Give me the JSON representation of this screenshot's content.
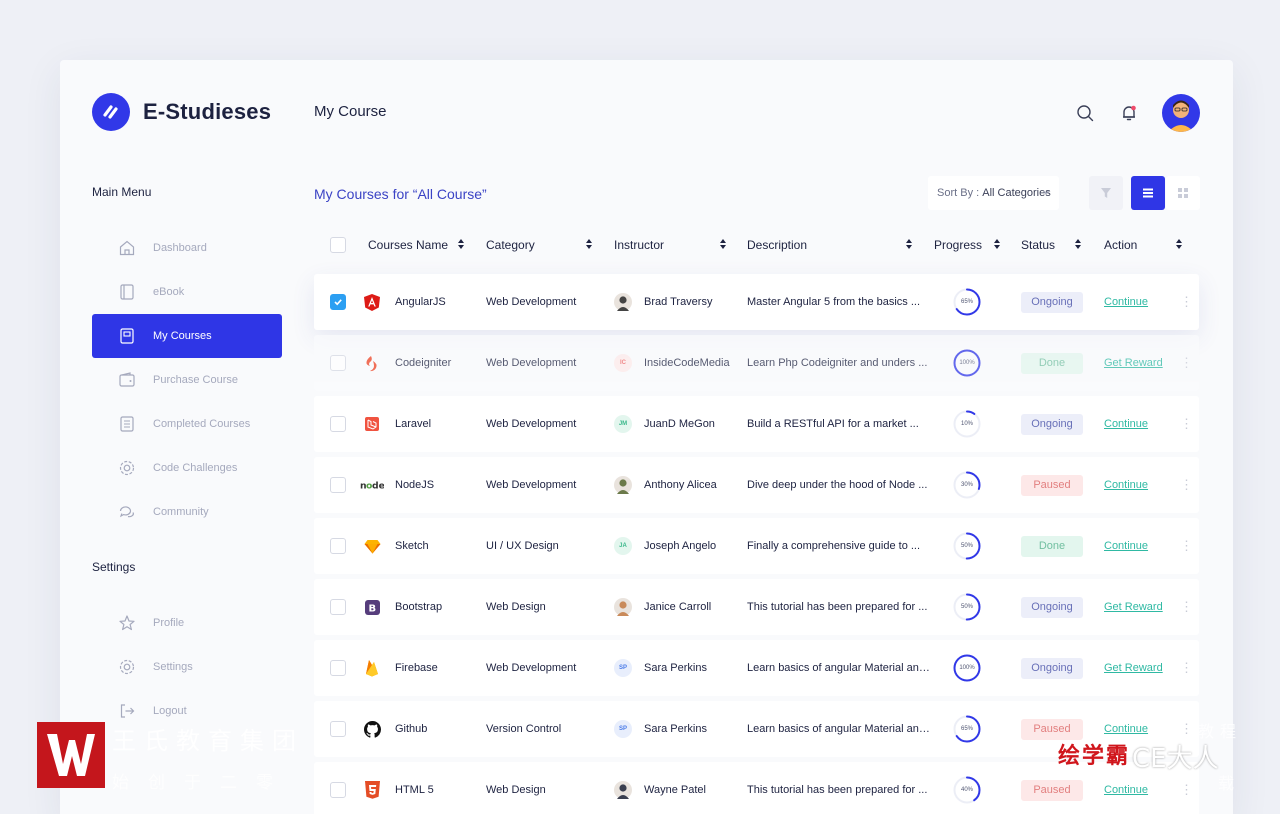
{
  "app": {
    "name": "E-Studieses",
    "page_title": "My Course"
  },
  "sidebar": {
    "main_menu_title": "Main Menu",
    "items": [
      {
        "label": "Dashboard",
        "icon": "home-icon"
      },
      {
        "label": "eBook",
        "icon": "book-icon"
      },
      {
        "label": "My Courses",
        "icon": "courses-icon",
        "active": true
      },
      {
        "label": "Purchase Course",
        "icon": "wallet-icon"
      },
      {
        "label": "Completed Courses",
        "icon": "checklist-icon"
      },
      {
        "label": "Code Challenges",
        "icon": "gear-icon"
      },
      {
        "label": "Community",
        "icon": "chat-icon"
      }
    ],
    "settings_title": "Settings",
    "settings_items": [
      {
        "label": "Profile",
        "icon": "star-icon"
      },
      {
        "label": "Settings",
        "icon": "gear-icon"
      },
      {
        "label": "Logout",
        "icon": "logout-icon"
      }
    ]
  },
  "content": {
    "subtitle": "My Courses for “All Course”",
    "sort": {
      "label": "Sort By :",
      "value": "All Categories"
    }
  },
  "table": {
    "headers": {
      "name": "Courses Name",
      "category": "Category",
      "instructor": "Instructor",
      "description": "Description",
      "progress": "Progress",
      "status": "Status",
      "action": "Action"
    },
    "rows": [
      {
        "name": "AngularJS",
        "category": "Web Development",
        "instructor": "Brad Traversy",
        "initials": "",
        "description": "Master Angular 5 from the basics ...",
        "progress": 65,
        "progress_label": "65%",
        "status": "Ongoing",
        "action": "Continue",
        "checked": true
      },
      {
        "name": "Codeigniter",
        "category": "Web Development",
        "instructor": "InsideCodeMedia",
        "initials": "IC",
        "description": "Learn Php Codeigniter and unders ...",
        "progress": 100,
        "progress_label": "100%",
        "status": "Done",
        "action": "Get Reward",
        "checked": false
      },
      {
        "name": "Laravel",
        "category": "Web Development",
        "instructor": "JuanD MeGon",
        "initials": "JM",
        "description": "Build a RESTful API for a market ...",
        "progress": 10,
        "progress_label": "10%",
        "status": "Ongoing",
        "action": "Continue",
        "checked": false
      },
      {
        "name": "NodeJS",
        "category": "Web Development",
        "instructor": "Anthony Alicea",
        "initials": "",
        "description": "Dive deep under the hood of Node ...",
        "progress": 30,
        "progress_label": "30%",
        "status": "Paused",
        "action": "Continue",
        "checked": false
      },
      {
        "name": "Sketch",
        "category": "UI / UX Design",
        "instructor": "Joseph Angelo",
        "initials": "JA",
        "description": "Finally a comprehensive guide to ...",
        "progress": 50,
        "progress_label": "50%",
        "status": "Done",
        "action": "Continue",
        "checked": false
      },
      {
        "name": "Bootstrap",
        "category": "Web Design",
        "instructor": "Janice Carroll",
        "initials": "",
        "description": "This tutorial has been prepared for ...",
        "progress": 50,
        "progress_label": "50%",
        "status": "Ongoing",
        "action": "Get Reward",
        "checked": false
      },
      {
        "name": "Firebase",
        "category": "Web Development",
        "instructor": "Sara Perkins",
        "initials": "SP",
        "description": "Learn basics of angular Material and ...",
        "progress": 100,
        "progress_label": "100%",
        "status": "Ongoing",
        "action": "Get Reward",
        "checked": false
      },
      {
        "name": "Github",
        "category": "Version Control",
        "instructor": "Sara Perkins",
        "initials": "SP",
        "description": "Learn basics of angular Material and ...",
        "progress": 65,
        "progress_label": "65%",
        "status": "Paused",
        "action": "Continue",
        "checked": false
      },
      {
        "name": "HTML 5",
        "category": "Web Design",
        "instructor": "Wayne Patel",
        "initials": "",
        "description": "This tutorial has been prepared for ...",
        "progress": 40,
        "progress_label": "40%",
        "status": "Paused",
        "action": "Continue",
        "checked": false
      }
    ]
  },
  "colors": {
    "accent": "#2f36e6",
    "link": "#2fb9a3",
    "ongoing": "#6870b8",
    "done": "#71bfa0",
    "paused": "#e27f7f"
  },
  "watermark": {
    "left_line1": "王氏教育集团",
    "left_line2": "始创于二零",
    "right_brand": "绘学霸",
    "right_text": "CE大人",
    "right_small1": "教程",
    "right_small2": "载"
  }
}
